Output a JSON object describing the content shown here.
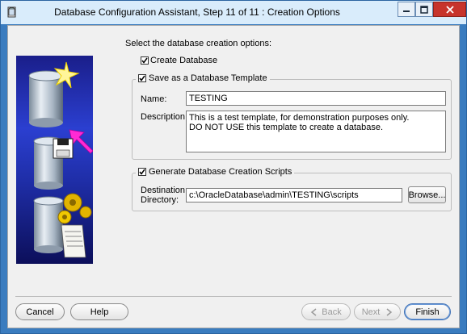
{
  "window": {
    "title": "Database Configuration Assistant, Step 11 of 11 : Creation Options",
    "icon": "oracle-dbca-icon",
    "controls": {
      "minimize": "minimize-icon",
      "maximize": "maximize-icon",
      "close": "close-icon"
    }
  },
  "main": {
    "intro": "Select the database creation options:",
    "create_database": {
      "label": "Create Database",
      "checked": true
    },
    "template": {
      "legend": "Save as a Database Template",
      "checked": true,
      "name_label": "Name:",
      "name_value": "TESTING",
      "description_label": "Description:",
      "description_value": "This is a test template, for demonstration purposes only.\nDO NOT USE this template to create a database."
    },
    "scripts": {
      "legend": "Generate Database Creation Scripts",
      "checked": true,
      "dest_label_line1": "Destination",
      "dest_label_line2": "Directory:",
      "dest_value": "c:\\OracleDatabase\\admin\\TESTING\\scripts",
      "browse_label": "Browse..."
    }
  },
  "footer": {
    "cancel": "Cancel",
    "help": "Help",
    "back": "Back",
    "next": "Next",
    "finish": "Finish"
  },
  "colors": {
    "accent": "#3a7cbf",
    "close_button": "#c7342c",
    "art_background": "#2b3fd0",
    "arrow": "#ff00cc"
  }
}
